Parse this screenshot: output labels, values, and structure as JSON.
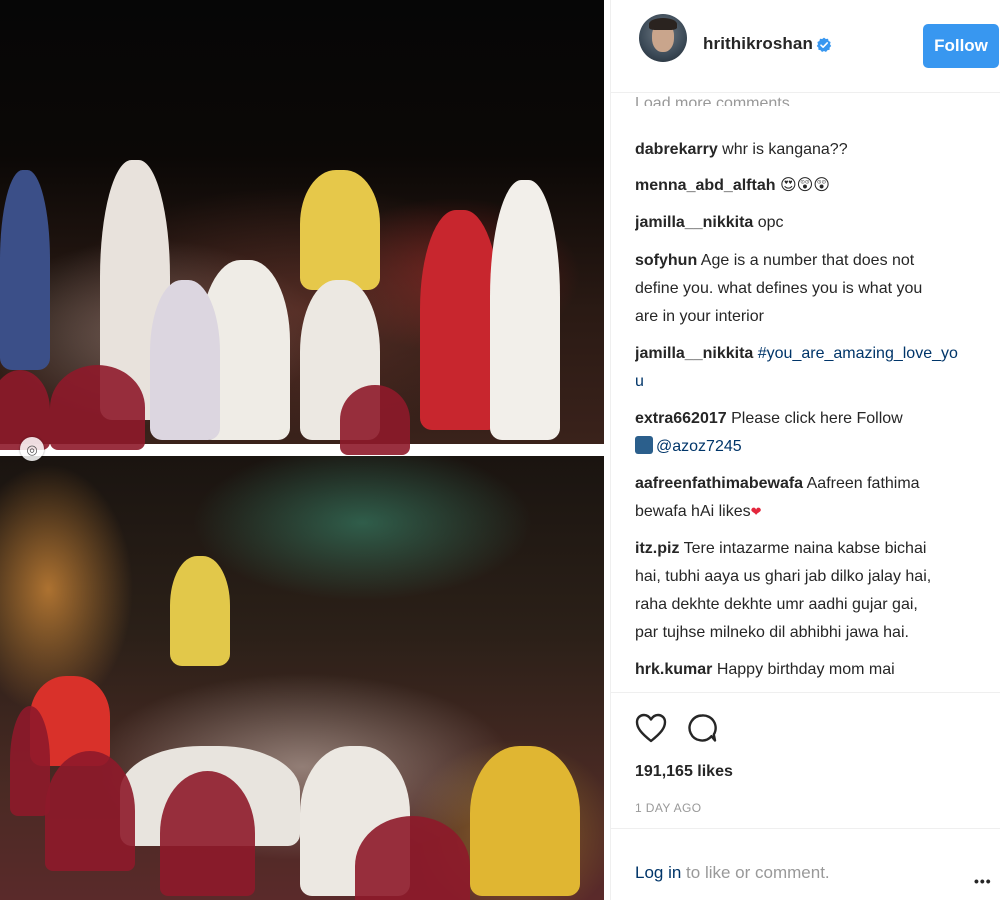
{
  "post": {
    "image_alt_top": "",
    "image_alt_bottom": ""
  },
  "header": {
    "username": "hrithikroshan",
    "follow_label": "Follow",
    "verified": true
  },
  "comments": {
    "load_more_label": "Load more comments",
    "items": [
      {
        "user": "dabrekarry",
        "text": "whr is kangana??"
      },
      {
        "user": "menna_abd_alftah",
        "text": "😍😲😲"
      },
      {
        "user": "jamilla__nikkita",
        "text": "opc"
      },
      {
        "user": "sofyhun",
        "text_line1": "Age is a number that does not",
        "text_line2": "define you. what defines you is what you",
        "text_line3": "are in your interior"
      },
      {
        "user": "jamilla__nikkita",
        "tag_line1": "#you_are_amazing_love_yo",
        "tag_line2": "u"
      },
      {
        "user": "extra662017",
        "text_line1": "Please click here Follow",
        "tag_line2": "@azoz7245"
      },
      {
        "user": "aafreenfathimabewafa",
        "text_line1": "Aafreen fathima",
        "text_line2": "bewafa hAi likes",
        "trailing_emoji": "❤"
      },
      {
        "user": "itz.piz",
        "text_line1": "Tere intazarme naina kabse bichai",
        "text_line2": "hai, tubhi aaya us ghari jab dilko jalay hai,",
        "text_line3": "raha dekhte dekhte umr aadhi gujar gai,",
        "text_line4": "par tujhse milneko dil abhibhi jawa hai."
      },
      {
        "user": "hrk.kumar",
        "text_line1": "Happy birthday mom mai"
      }
    ]
  },
  "actions": {
    "likes_text": "191,165 likes",
    "timestamp": "1 DAY AGO"
  },
  "footer": {
    "login_link": "Log in",
    "login_rest": " to like or comment.",
    "more_label": "•••"
  },
  "colors": {
    "follow_bg": "#3897f0",
    "link": "#003569",
    "muted": "#999999",
    "verified": "#3897f0"
  }
}
